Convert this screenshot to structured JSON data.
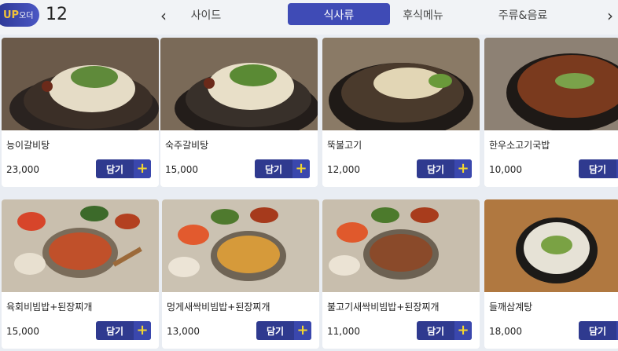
{
  "header": {
    "logo_text": "UP",
    "logo_sub": "오더",
    "cart_count": "12",
    "prev_icon": "chevron-left-icon",
    "next_icon": "chevron-right-icon",
    "tabs": [
      {
        "label": "사이드",
        "active": false
      },
      {
        "label": "식사류",
        "active": true
      },
      {
        "label": "후식메뉴",
        "active": false
      },
      {
        "label": "주류&음료",
        "active": false
      }
    ]
  },
  "menu": {
    "add_label": "담기",
    "plus_icon": "plus-icon",
    "items": [
      {
        "name": "능이갈비탕",
        "price": "23,000"
      },
      {
        "name": "숙주갈비탕",
        "price": "15,000"
      },
      {
        "name": "뚝불고기",
        "price": "12,000"
      },
      {
        "name": "한우소고기국밥",
        "price": "10,000"
      },
      {
        "name": "육회비빔밥+된장찌개",
        "price": "15,000"
      },
      {
        "name": "멍게새싹비빔밥+된장찌개",
        "price": "13,000"
      },
      {
        "name": "불고기새싹비빔밥+된장찌개",
        "price": "11,000"
      },
      {
        "name": "들깨삼계탕",
        "price": "18,000"
      }
    ]
  },
  "colors": {
    "accent": "#3f4bb6",
    "button": "#2f3a8f",
    "plus": "#f3d62e"
  }
}
